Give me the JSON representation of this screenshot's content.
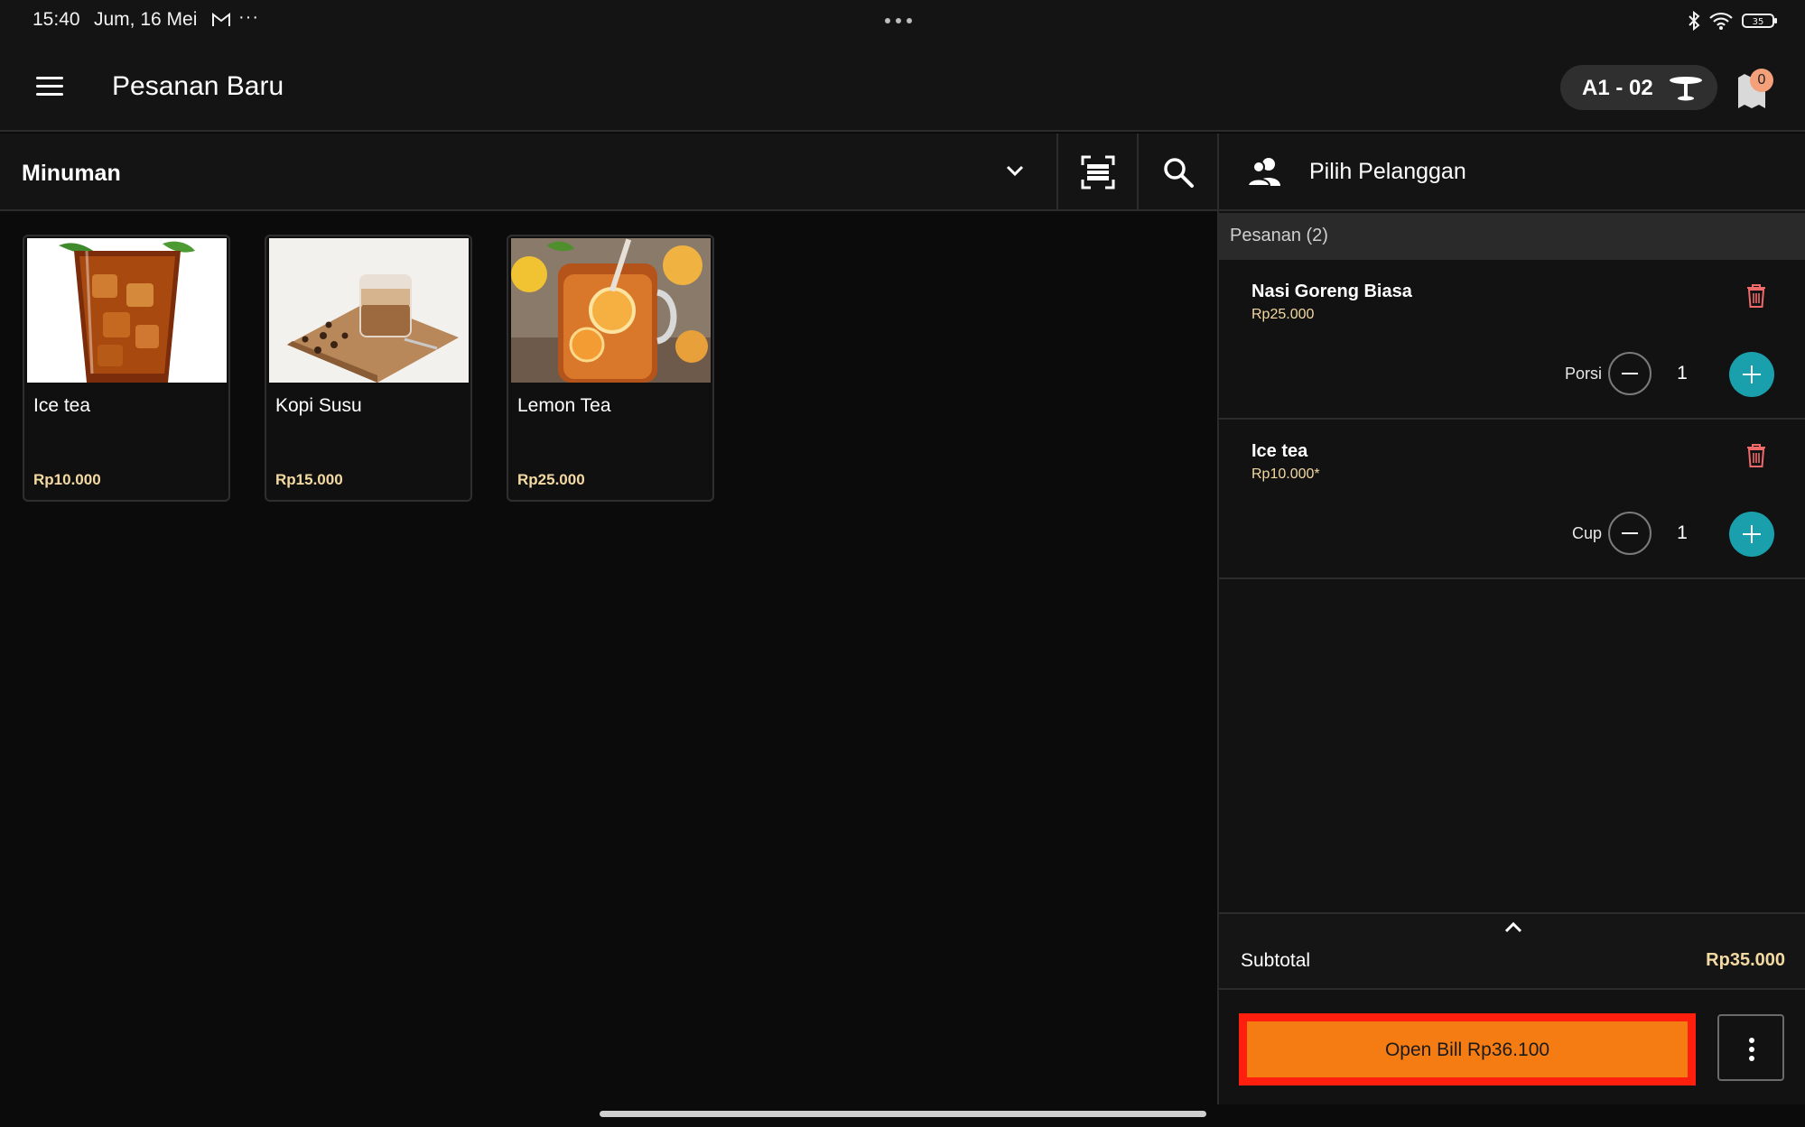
{
  "status_bar": {
    "time": "15:40",
    "date": "Jum, 16 Mei",
    "more": "···",
    "battery": "35"
  },
  "app_bar": {
    "title": "Pesanan Baru",
    "table_label": "A1 - 02",
    "notification_count": "0"
  },
  "filter": {
    "category": "Minuman"
  },
  "products": [
    {
      "name": "Ice tea",
      "price": "Rp10.000"
    },
    {
      "name": "Kopi Susu",
      "price": "Rp15.000"
    },
    {
      "name": "Lemon Tea",
      "price": "Rp25.000"
    }
  ],
  "order_panel": {
    "customer_label": "Pilih Pelanggan",
    "header": "Pesanan (2)",
    "items": [
      {
        "name": "Nasi Goreng Biasa",
        "price": "Rp25.000",
        "unit": "Porsi",
        "qty": "1"
      },
      {
        "name": "Ice tea",
        "price": "Rp10.000*",
        "unit": "Cup",
        "qty": "1"
      }
    ],
    "subtotal_label": "Subtotal",
    "subtotal_value": "Rp35.000",
    "open_bill_label": "Open Bill Rp36.100"
  },
  "colors": {
    "accent_teal": "#1aa0ad",
    "accent_orange": "#f57c13",
    "highlight_red": "#ff1f0f",
    "price_gold": "#f3d9a2"
  }
}
